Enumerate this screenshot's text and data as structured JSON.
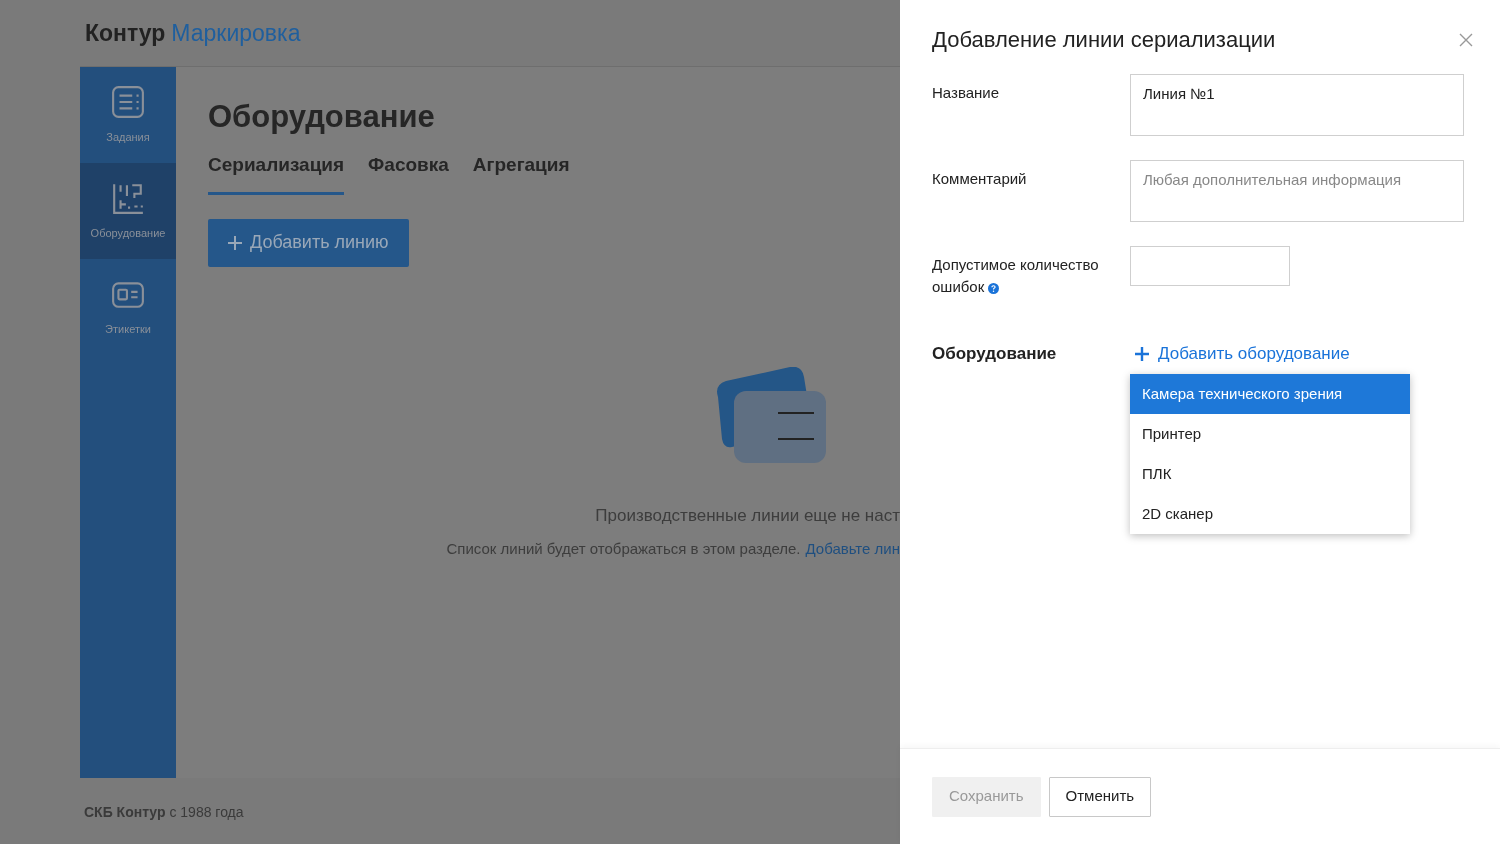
{
  "brand": {
    "name": "Контур",
    "product": "Маркировка"
  },
  "sidebar": {
    "items": [
      {
        "kind": "tasks",
        "label": "Задания",
        "selected": false
      },
      {
        "kind": "equipment",
        "label": "Оборудование",
        "selected": true
      },
      {
        "kind": "labels",
        "label": "Этикетки",
        "selected": false
      }
    ]
  },
  "page": {
    "title": "Оборудование",
    "tabs": [
      {
        "label": "Сериализация",
        "selected": true
      },
      {
        "label": "Фасовка",
        "selected": false
      },
      {
        "label": "Агрегация",
        "selected": false
      }
    ],
    "add_button": "Добавить линию"
  },
  "empty_state": {
    "title": "Производственные линии еще не наст",
    "text": "Список линий будет отображаться в этом разделе.",
    "link": "Добавьте лин"
  },
  "footer": "**СКБ Контур** с 1988 года",
  "panel": {
    "title": "Добавление линии сериализации",
    "fields": [
      {
        "kind": "text",
        "label": "Название",
        "value": "Линия №1"
      },
      {
        "kind": "text",
        "label": "Комментарий",
        "placeholder": "Любая дополнительная информация"
      },
      {
        "kind": "number",
        "label": "Допустимое количество ошибок",
        "help": true
      }
    ],
    "equipment": {
      "label": "Оборудование",
      "add_link": "Добавить оборудование",
      "menu": [
        {
          "label": "Камера технического зрения",
          "selected": true
        },
        {
          "label": "Принтер",
          "selected": false
        },
        {
          "label": "ПЛК",
          "selected": false
        },
        {
          "label": "2D сканер",
          "selected": false
        }
      ]
    },
    "buttons": [
      {
        "label": "Сохранить",
        "disabled": true
      },
      {
        "label": "Отменить",
        "disabled": false
      }
    ]
  }
}
